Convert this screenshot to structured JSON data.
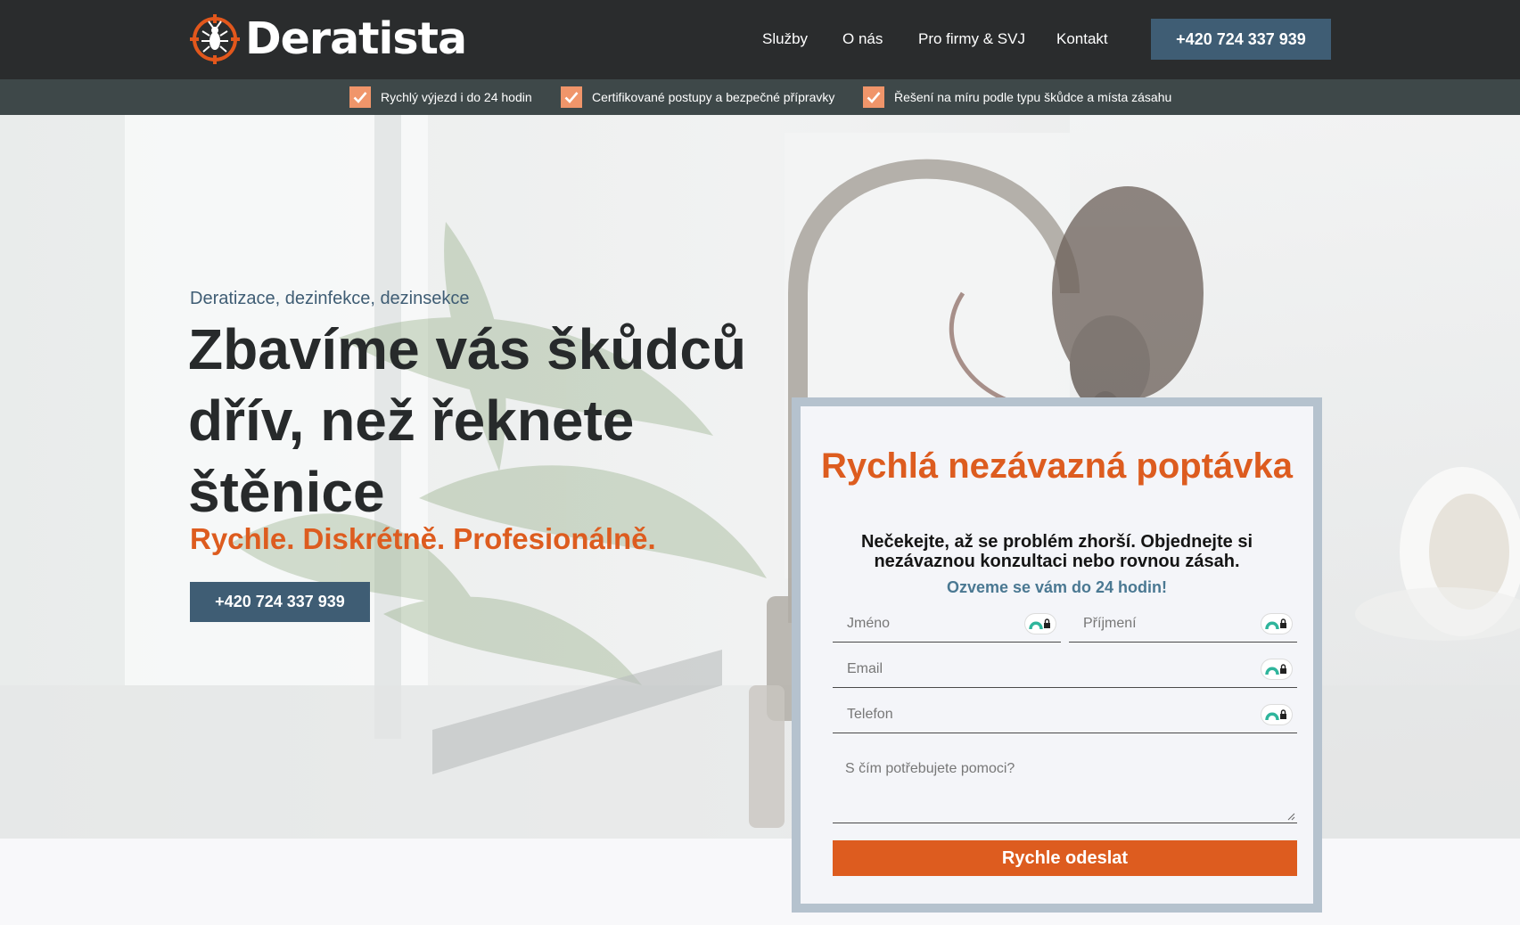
{
  "brand": {
    "name": "Deratista",
    "logo_icon": "cockroach-crosshair-icon"
  },
  "nav": {
    "items": [
      {
        "label": "Služby"
      },
      {
        "label": "O nás"
      },
      {
        "label": "Pro firmy & SVJ"
      },
      {
        "label": "Kontakt"
      }
    ],
    "phone_button": "+420 724 337 939"
  },
  "benefits": [
    {
      "text": "Rychlý výjezd i do 24 hodin",
      "icon": "check-icon"
    },
    {
      "text": "Certifikované postupy a bezpečné přípravky",
      "icon": "check-icon"
    },
    {
      "text": "Řešení na míru podle typu škůdce a místa zásahu",
      "icon": "check-icon"
    }
  ],
  "hero": {
    "eyebrow": "Deratizace, dezinfekce, dezinsekce",
    "headline": "Zbavíme vás škůdců dřív, než řeknete štěnice",
    "tagline": "Rychle. Diskrétně. Profesionálně.",
    "phone_button": "+420 724 337 939",
    "image": "rat-on-kitchen-faucet"
  },
  "form": {
    "title": "Rychlá nezávazná poptávka",
    "subtitle": "Nečekejte, až se problém zhorší. Objednejte si nezávaznou konzultaci nebo rovnou zásah.",
    "note": "Ozveme se vám do 24 hodin!",
    "fields": {
      "first_name": {
        "placeholder": "Jméno"
      },
      "last_name": {
        "placeholder": "Příjmení"
      },
      "email": {
        "placeholder": "Email"
      },
      "phone": {
        "placeholder": "Telefon"
      },
      "message": {
        "placeholder": "S čím potřebujete pomoci?"
      }
    },
    "submit": "Rychle odeslat"
  },
  "colors": {
    "topbar": "#2a2c2d",
    "benefit_bar": "#3e4849",
    "accent_orange": "#dd5c1f",
    "steel_blue": "#3f5d74",
    "check_bg": "#f0956a"
  }
}
